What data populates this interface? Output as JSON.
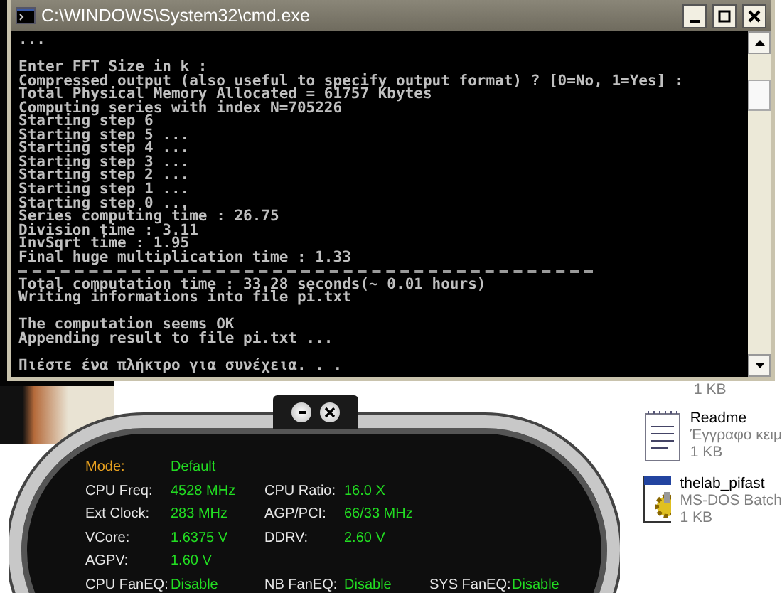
{
  "console_window": {
    "title": "C:\\WINDOWS\\System32\\cmd.exe",
    "lines": [
      {
        "kind": "text",
        "text": "..."
      },
      {
        "kind": "blank"
      },
      {
        "kind": "text",
        "text": "Enter FFT Size in k :"
      },
      {
        "kind": "text",
        "text": "Compressed output (also useful to specify output format) ? [0=No, 1=Yes] :"
      },
      {
        "kind": "text",
        "text": "Total Physical Memory Allocated = 61757 Kbytes"
      },
      {
        "kind": "text",
        "text": "Computing series with index N=705226"
      },
      {
        "kind": "text",
        "text": "Starting step 6"
      },
      {
        "kind": "text",
        "text": "Starting step 5 ..."
      },
      {
        "kind": "text",
        "text": "Starting step 4 ..."
      },
      {
        "kind": "text",
        "text": "Starting step 3 ..."
      },
      {
        "kind": "text",
        "text": "Starting step 2 ..."
      },
      {
        "kind": "text",
        "text": "Starting step 1 ..."
      },
      {
        "kind": "text",
        "text": "Starting step 0 ..."
      },
      {
        "kind": "text",
        "text": "Series computing time : 26.75"
      },
      {
        "kind": "text",
        "text": "Division time : 3.11"
      },
      {
        "kind": "text",
        "text": "InvSqrt time : 1.95"
      },
      {
        "kind": "text",
        "text": "Final huge multiplication time : 1.33"
      },
      {
        "kind": "rule"
      },
      {
        "kind": "text",
        "text": "Total computation time : 33.28 seconds(~ 0.01 hours)"
      },
      {
        "kind": "text",
        "text": "Writing informations into file pi.txt"
      },
      {
        "kind": "blank"
      },
      {
        "kind": "text",
        "text": "The computation seems OK"
      },
      {
        "kind": "text",
        "text": "Appending result to file pi.txt ..."
      },
      {
        "kind": "blank"
      },
      {
        "kind": "text",
        "text": "Πιέστε ένα πλήκτρο για συνέχεια. . ."
      }
    ]
  },
  "files": [
    {
      "kind": "size_only",
      "lines": [
        "1 KB"
      ]
    },
    {
      "kind": "text_document",
      "lines": [
        "Readme",
        "Έγγραφο κειμ",
        "1 KB"
      ]
    },
    {
      "kind": "batch_file",
      "lines": [
        "thelab_pifast",
        "MS-DOS Batch",
        "1 KB"
      ]
    }
  ],
  "monitor_panel": {
    "mode": {
      "label": "Mode:",
      "value": "Default"
    },
    "rows": [
      [
        {
          "label": "CPU Freq:",
          "value": "4528 MHz"
        },
        {
          "label": "CPU Ratio:",
          "value": "16.0 X"
        }
      ],
      [
        {
          "label": "Ext Clock:",
          "value": "283 MHz"
        },
        {
          "label": "AGP/PCI:",
          "value": "66/33 MHz"
        }
      ],
      [
        {
          "label": "VCore:",
          "value": "1.6375 V"
        },
        {
          "label": "DDRV:",
          "value": "2.60 V"
        }
      ],
      [
        {
          "label": "AGPV:",
          "value": "1.60 V"
        }
      ],
      [
        {
          "label": "CPU FanEQ:",
          "value": "Disable"
        },
        {
          "label": "NB FanEQ:",
          "value": "Disable"
        },
        {
          "label": "SYS FanEQ:",
          "value": "Disable"
        }
      ]
    ]
  }
}
